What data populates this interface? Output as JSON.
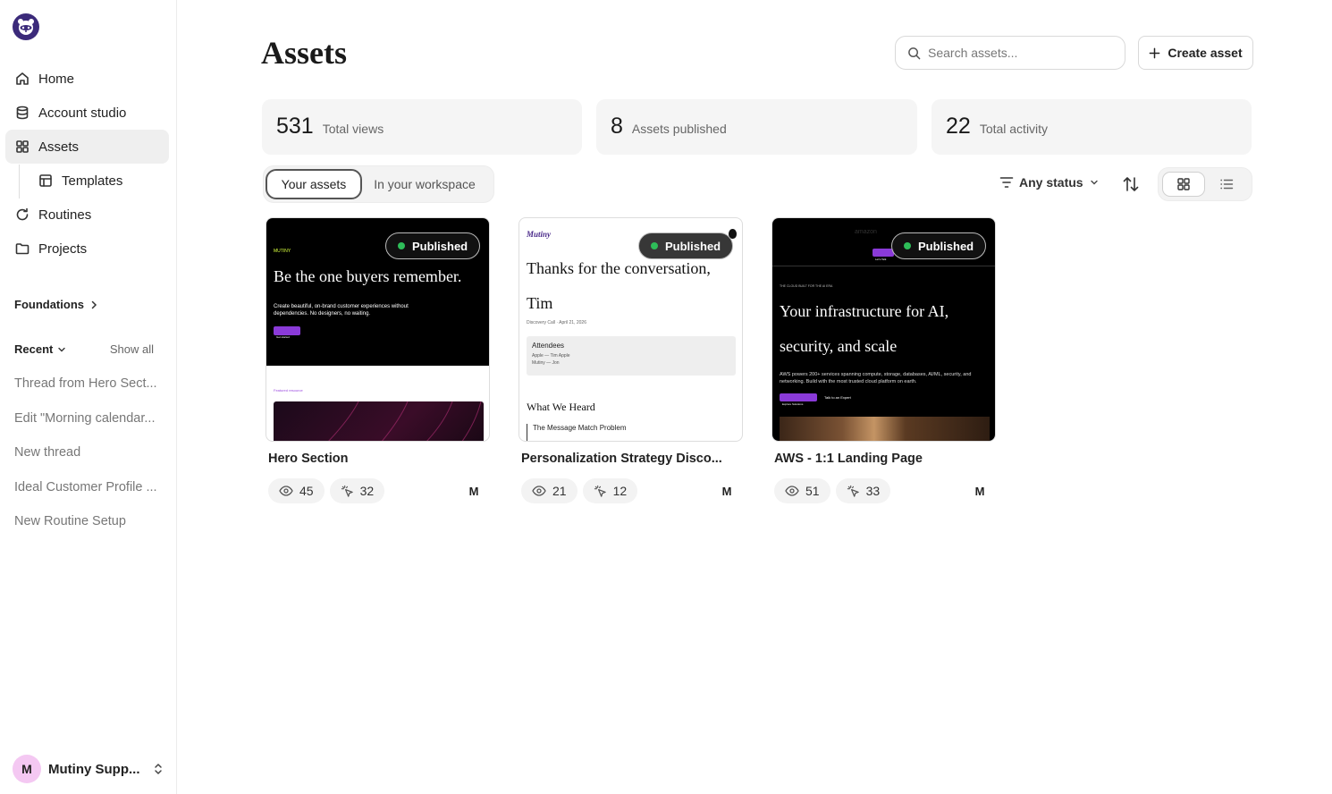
{
  "sidebar": {
    "nav": [
      {
        "label": "Home",
        "icon": "home-icon"
      },
      {
        "label": "Account studio",
        "icon": "database-icon"
      },
      {
        "label": "Assets",
        "icon": "grid-icon",
        "active": true
      },
      {
        "label": "Templates",
        "icon": "layout-icon"
      },
      {
        "label": "Routines",
        "icon": "refresh-icon"
      },
      {
        "label": "Projects",
        "icon": "folder-icon"
      }
    ],
    "foundations_label": "Foundations",
    "recent_label": "Recent",
    "show_all_label": "Show all",
    "recent_items": [
      "Thread from Hero Sect...",
      "Edit \"Morning calendar...",
      "New thread",
      "Ideal Customer Profile ...",
      "New Routine Setup"
    ],
    "user": {
      "initial": "M",
      "name": "Mutiny Supp..."
    }
  },
  "header": {
    "title": "Assets",
    "search_placeholder": "Search assets...",
    "create_label": "Create asset"
  },
  "stats": [
    {
      "value": "531",
      "label": "Total views"
    },
    {
      "value": "8",
      "label": "Assets published"
    },
    {
      "value": "22",
      "label": "Total activity"
    }
  ],
  "tabs": {
    "your_assets": "Your assets",
    "workspace": "In your workspace"
  },
  "filters": {
    "status_label": "Any status"
  },
  "cards": [
    {
      "title": "Hero Section",
      "status": "Published",
      "views": "45",
      "clicks": "32",
      "owner": "M",
      "preview": {
        "logo": "MUTINY",
        "headline": "Be the one buyers remember.",
        "sub": "Create beautiful, on-brand customer experiences without dependencies. No designers, no waiting.",
        "cta": "Get started",
        "featured": "Featured resource"
      }
    },
    {
      "title": "Personalization Strategy Disco...",
      "status": "Published",
      "views": "21",
      "clicks": "12",
      "owner": "M",
      "preview": {
        "logo": "Mutiny",
        "headline": "Thanks for the conversation, Tim",
        "meta": "Discovery Call · April 21, 2026",
        "attendees_label": "Attendees",
        "attendees_1": "Apple — Tim Apple",
        "attendees_2": "Mutiny — Jon",
        "section": "What We Heard",
        "quote": "The Message Match Problem"
      }
    },
    {
      "title": "AWS - 1:1 Landing Page",
      "status": "Published",
      "views": "51",
      "clicks": "33",
      "owner": "M",
      "preview": {
        "logo": "amazon",
        "nav_cta": "Let's Talk",
        "kicker": "THE CLOUD BUILT FOR THE AI ERA",
        "headline": "Your infrastructure for AI, security, and scale",
        "sub": "AWS powers 200+ services spanning compute, storage, databases, AI/ML, security, and networking. Build with the most trusted cloud platform on earth.",
        "cta1": "Explore Solutions",
        "cta2": "Talk to an Expert"
      }
    }
  ],
  "colors": {
    "brand_purple": "#3b2a7a",
    "published_green": "#2ebd59",
    "accent_purple": "#8a3ad8"
  }
}
